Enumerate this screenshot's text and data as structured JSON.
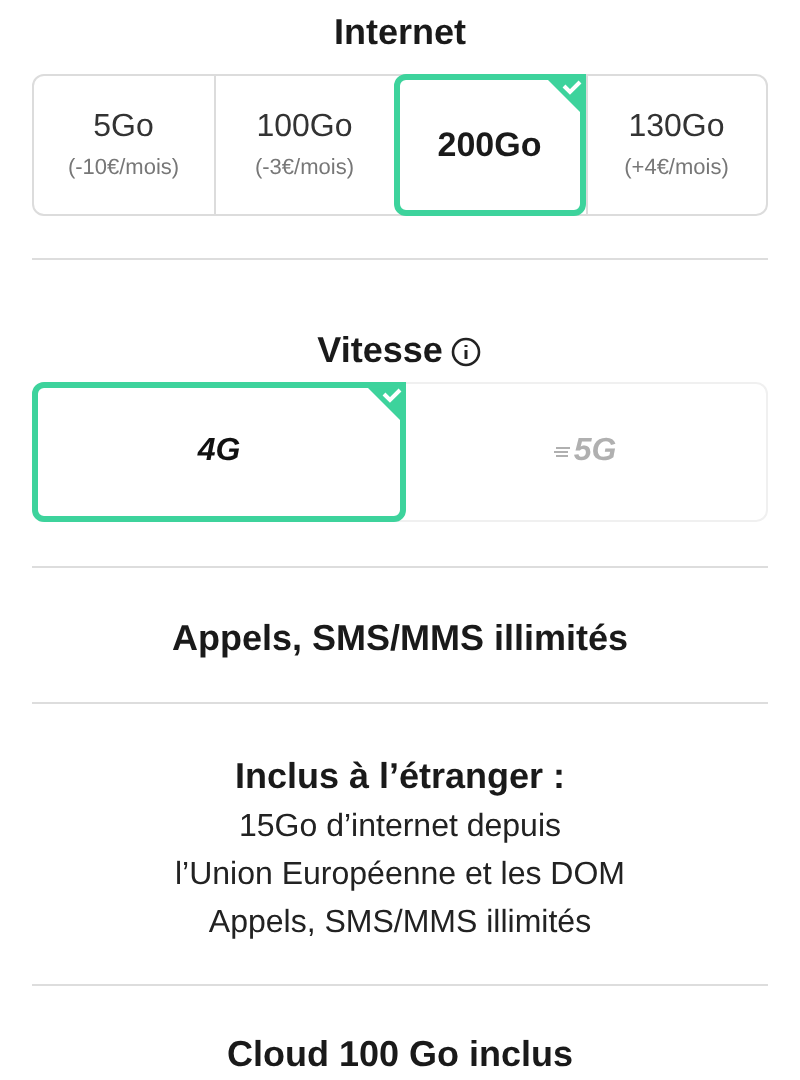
{
  "internet": {
    "title": "Internet",
    "options": [
      {
        "label": "5Go",
        "price": "(-10€/mois)",
        "selected": false
      },
      {
        "label": "100Go",
        "price": "(-3€/mois)",
        "selected": false
      },
      {
        "label": "200Go",
        "selected": true
      },
      {
        "label": "130Go",
        "price": "(+4€/mois)",
        "selected": false
      }
    ]
  },
  "speed": {
    "title": "Vitesse",
    "options": [
      {
        "label": "4G",
        "selected": true,
        "disabled": false
      },
      {
        "label": "5G",
        "selected": false,
        "disabled": true
      }
    ]
  },
  "calls": {
    "title": "Appels, SMS/MMS illimités"
  },
  "abroad": {
    "title": "Inclus à l’étranger :",
    "lines": [
      "15Go d’internet depuis",
      "l’Union Européenne et les DOM",
      "Appels, SMS/MMS illimités"
    ]
  },
  "cloud": {
    "title": "Cloud 100 Go inclus"
  }
}
